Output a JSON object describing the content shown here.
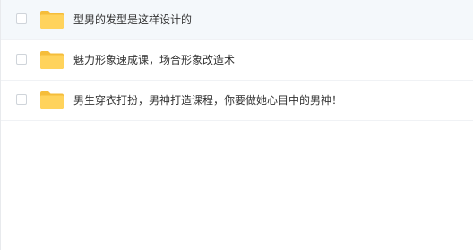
{
  "files": [
    {
      "name": "型男的发型是这样设计的",
      "icon": "folder-icon",
      "selected": true
    },
    {
      "name": "魅力形象速成课，场合形象改造术",
      "icon": "folder-icon",
      "selected": false
    },
    {
      "name": "男生穿衣打扮，男神打造课程，你要做她心目中的男神！",
      "icon": "folder-icon",
      "selected": false
    }
  ],
  "colors": {
    "folder": "#ffd35c",
    "folder_dark": "#f5bd3a",
    "hover_row": "#f4f8fb"
  }
}
